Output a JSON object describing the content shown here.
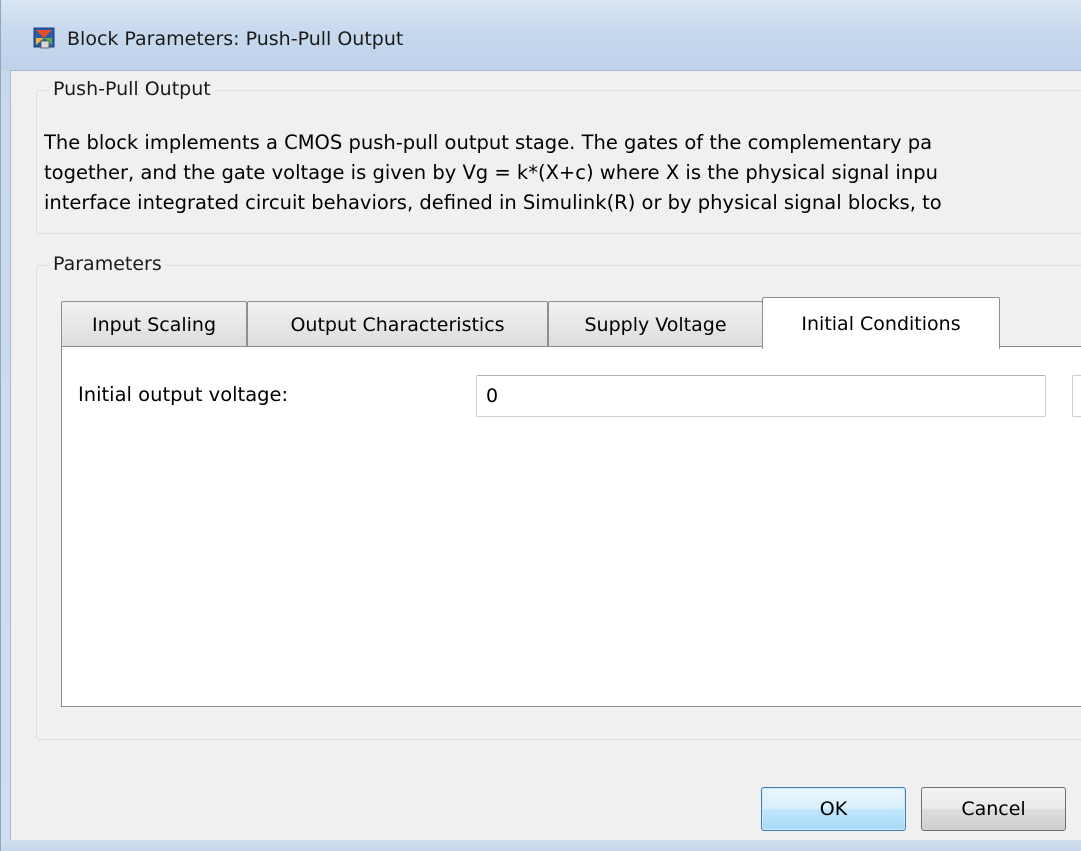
{
  "window": {
    "title": "Block Parameters: Push-Pull Output",
    "icon": "simulink-block-icon"
  },
  "description_group": {
    "title": "Push-Pull Output",
    "lines": [
      "The block implements a CMOS push-pull output stage. The gates of the complementary pa",
      "together, and the gate voltage is given by Vg = k*(X+c) where X is the physical signal inpu",
      "interface integrated circuit behaviors, defined in Simulink(R) or by physical signal blocks, to"
    ]
  },
  "parameters_group": {
    "title": "Parameters",
    "tabs": [
      {
        "label": "Input Scaling",
        "active": false
      },
      {
        "label": "Output Characteristics",
        "active": false
      },
      {
        "label": "Supply Voltage",
        "active": false
      },
      {
        "label": "Initial Conditions",
        "active": true
      }
    ],
    "fields": [
      {
        "label": "Initial output voltage:",
        "value": "0"
      }
    ]
  },
  "buttons": {
    "ok_label": "OK",
    "cancel_label": "Cancel"
  },
  "colors": {
    "title_bar": "#c8d9ee",
    "dialog_background": "#f0f0f0",
    "default_button_border": "#3c7fb1"
  }
}
